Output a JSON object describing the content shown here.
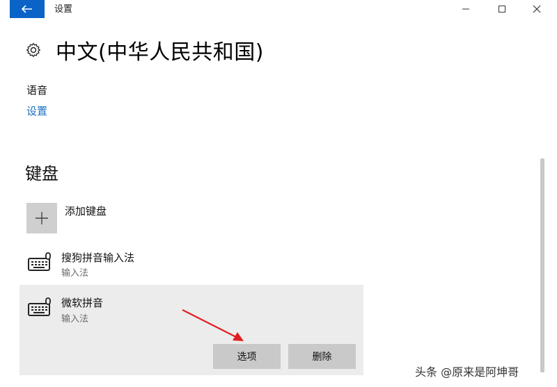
{
  "window": {
    "title": "设置",
    "back_icon": "back-arrow-icon",
    "controls": [
      "minimize-icon",
      "maximize-icon",
      "close-icon"
    ],
    "accent_color": "#0b63c8"
  },
  "page": {
    "icon": "gear-icon",
    "title": "中文(中华人民共和国)"
  },
  "speech": {
    "label": "语音",
    "settings_link": "设置"
  },
  "keyboard": {
    "header": "键盘",
    "add_label": "添加键盘",
    "items": [
      {
        "name": "搜狗拼音输入法",
        "type": "输入法",
        "icon": "keyboard-icon"
      },
      {
        "name": "微软拼音",
        "type": "输入法",
        "icon": "keyboard-icon",
        "selected": true
      }
    ],
    "actions": {
      "options": "选项",
      "delete": "删除"
    }
  },
  "watermark": "头条 @原来是阿坤哥"
}
